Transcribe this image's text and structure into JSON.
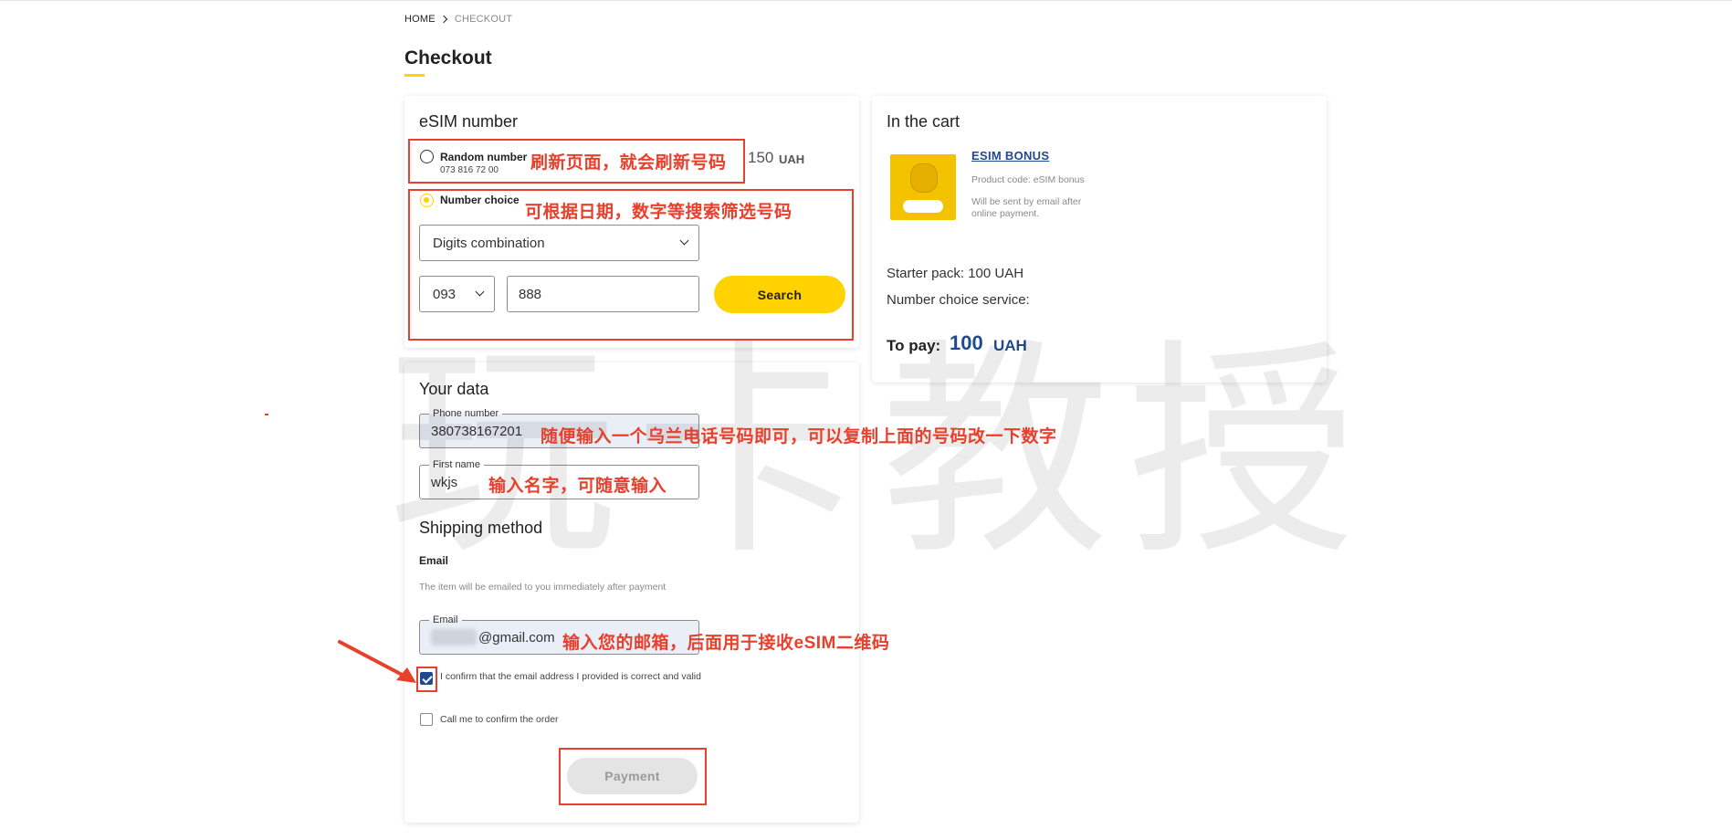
{
  "breadcrumb": {
    "home": "HOME",
    "current": "CHECKOUT"
  },
  "page": {
    "title": "Checkout"
  },
  "esim": {
    "title": "eSIM number",
    "random": {
      "label": "Random number",
      "number": "073 816 72 00",
      "price": "150",
      "currency": "UAH"
    },
    "choice": {
      "label": "Number choice"
    },
    "filter_select": "Digits combination",
    "prefix_select": "093",
    "digits_value": "888",
    "search_label": "Search"
  },
  "your_data": {
    "title": "Your data",
    "phone": {
      "label": "Phone number",
      "value": "380738167201"
    },
    "first_name": {
      "label": "First name",
      "value": "wkjs"
    }
  },
  "shipping": {
    "title": "Shipping method",
    "method": "Email",
    "description": "The item will be emailed to you immediately after payment",
    "email": {
      "label": "Email",
      "value": "@gmail.com"
    },
    "confirm_label": "I confirm that the email address I provided is correct and valid",
    "call_label": "Call me to confirm the order",
    "payment_label": "Payment"
  },
  "cart": {
    "title": "In the cart",
    "product": {
      "name": "ESIM BONUS",
      "code": "Product code: eSIM bonus",
      "delivery": "Will be sent by email after online payment."
    },
    "starter_pack": "Starter pack:  100 UAH",
    "number_choice_service": "Number choice service:",
    "to_pay_label": "To pay:",
    "to_pay_value": "100",
    "to_pay_currency": "UAH"
  },
  "annotations": {
    "refresh": "刷新页面，就会刷新号码",
    "filter": "可根据日期，数字等搜索筛选号码",
    "phone": "随便输入一个乌兰电话号码即可，可以复制上面的号码改一下数字",
    "name": "输入名字，可随意输入",
    "email": "输入您的邮箱，后面用于接收eSIM二维码"
  },
  "watermark": "玩卡教授",
  "colors": {
    "accent": "#ffd200",
    "link": "#1f4a8f",
    "annotation": "#e8402c"
  }
}
